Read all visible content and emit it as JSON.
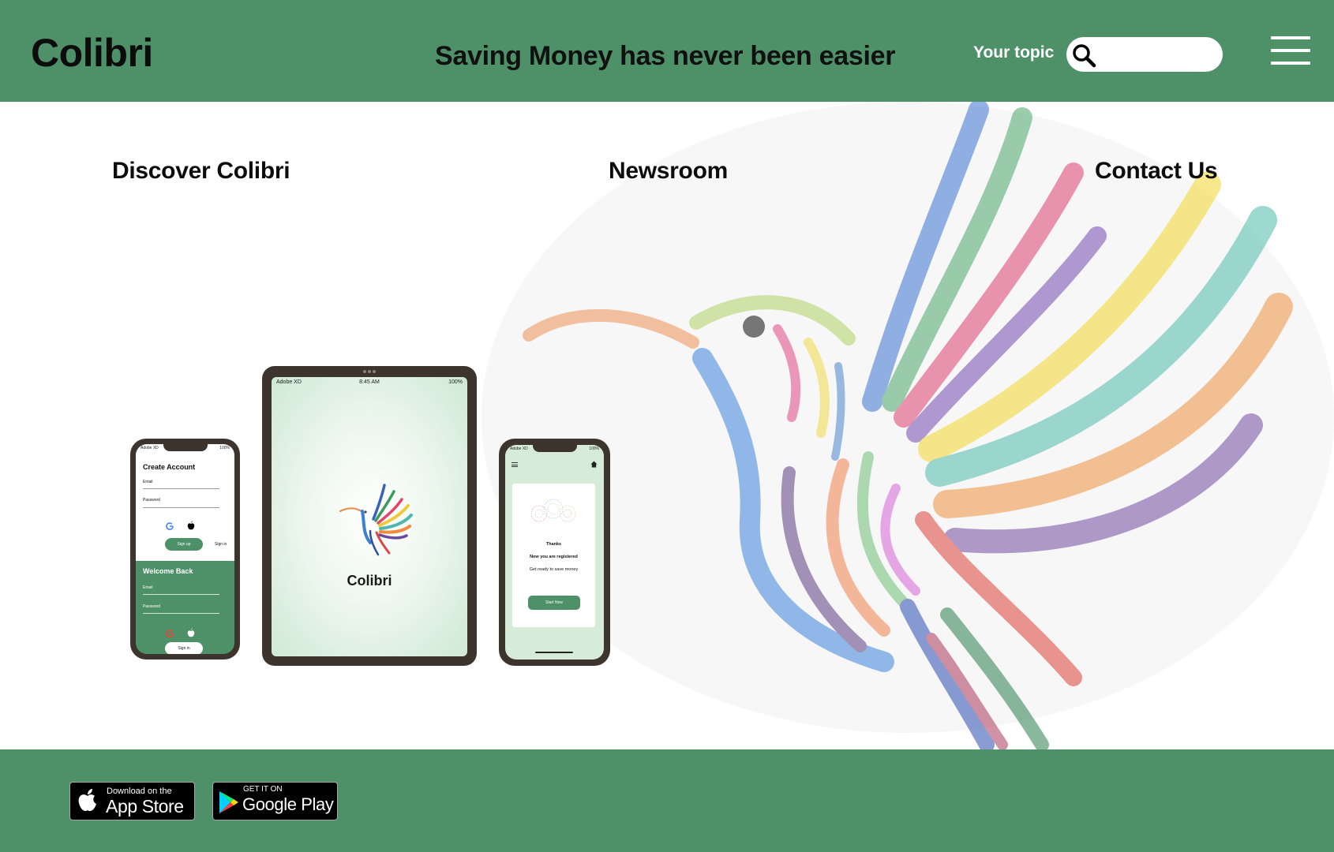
{
  "header": {
    "logo": "Colibri",
    "tagline": "Saving Money has never been easier",
    "topic_label": "Your topic",
    "search_placeholder": ""
  },
  "nav": {
    "discover": "Discover Colibri",
    "newsroom": "Newsroom",
    "contact": "Contact Us"
  },
  "devices": {
    "phone1": {
      "status_left": "Adobe XD",
      "status_right": "100%",
      "create_title": "Create Account",
      "email_label": "Email",
      "password_label": "Password",
      "signup_button": "Sign up",
      "signin_link": "Sign in",
      "welcome_title": "Welcome Back",
      "email_label2": "Email",
      "password_label2": "Password",
      "signin_button": "Sign in"
    },
    "tablet": {
      "status_left": "Adobe XD",
      "status_time": "8:45 AM",
      "status_right": "100%",
      "title": "Colibri"
    },
    "phone2": {
      "status_left": "Adobe XD",
      "status_right": "100%",
      "thanks": "Thanks",
      "registered": "Now you are registered",
      "ready": "Get ready to save money",
      "start_button": "Start Now"
    }
  },
  "footer": {
    "appstore_small": "Download on the",
    "appstore_big": "App Store",
    "googleplay_small": "GET IT ON",
    "googleplay_big": "Google Play"
  },
  "colors": {
    "brand_green": "#4e9168",
    "white": "#ffffff",
    "dark_text": "#0c0c0c"
  }
}
